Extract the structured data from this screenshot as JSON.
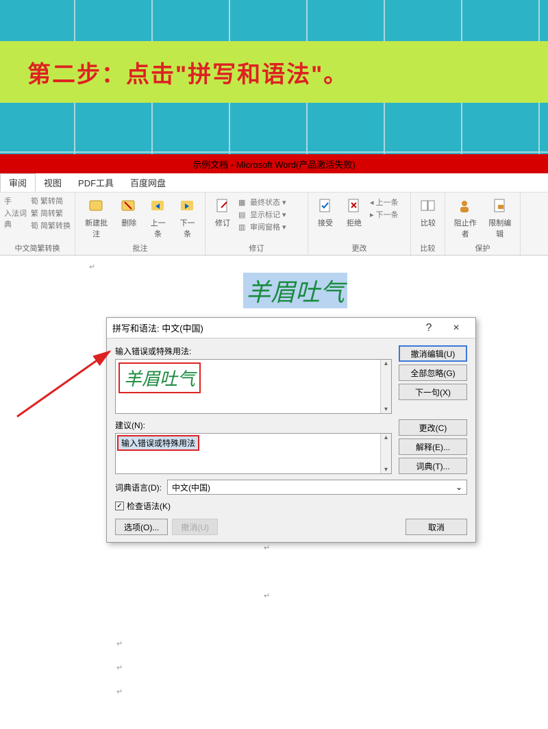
{
  "banner": {
    "text": "第二步：点击\"拼写和语法\"。"
  },
  "window": {
    "title": "示例文档 - Microsoft Word(产品激活失败)"
  },
  "tabs": {
    "review": "审阅",
    "view": "视图",
    "pdf": "PDF工具",
    "baidu": "百度网盘"
  },
  "ribbon": {
    "g1": {
      "dict": "入法词典",
      "c1": "繁转简",
      "c2": "简转繁",
      "c3": "简繁转换",
      "label": "中文简繁转换"
    },
    "g2": {
      "new_comment": "新建批注",
      "delete": "删除",
      "prev": "上一条",
      "next": "下一条",
      "label": "批注"
    },
    "g3": {
      "track": "修订",
      "final": "最终状态",
      "show_mark": "显示标记",
      "review_pane": "审阅窗格",
      "label": "修订"
    },
    "g4": {
      "accept": "接受",
      "reject": "拒绝",
      "prev": "上一条",
      "next": "下一条",
      "label": "更改"
    },
    "g5": {
      "compare": "比较",
      "label": "比较"
    },
    "g6": {
      "block": "阻止作者",
      "restrict": "限制编辑",
      "label": "保护"
    }
  },
  "document": {
    "text": "羊眉吐气"
  },
  "dialog": {
    "title": "拼写和语法: 中文(中国)",
    "help": "?",
    "close": "×",
    "error_label": "输入错误或特殊用法:",
    "error_text": "羊眉吐气",
    "suggest_label": "建议(N):",
    "suggest_text": "输入错误或特殊用法",
    "lang_label": "词典语言(D):",
    "lang_value": "中文(中国)",
    "check_grammar": "检查语法(K)",
    "btn_undo": "撤消编辑(U)",
    "btn_ignore_all": "全部忽略(G)",
    "btn_next": "下一句(X)",
    "btn_change": "更改(C)",
    "btn_explain": "解释(E)...",
    "btn_dict": "词典(T)...",
    "btn_options": "选项(O)...",
    "btn_undo2": "撤消(U)",
    "btn_cancel": "取消"
  }
}
